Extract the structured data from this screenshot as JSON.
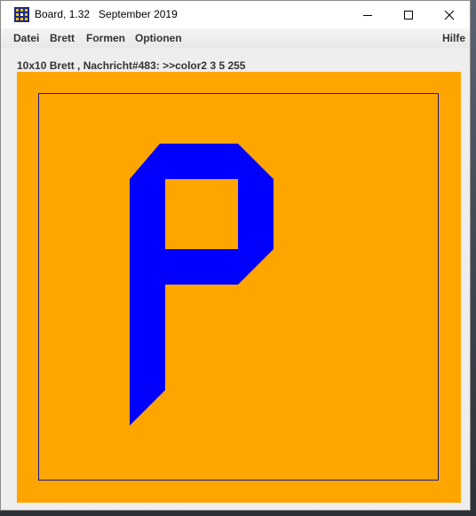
{
  "window": {
    "title": "Board, 1.32   September 2019"
  },
  "title_buttons": {
    "minimize_icon": "minimize-icon",
    "maximize_icon": "maximize-icon",
    "close_icon": "close-icon"
  },
  "menu": {
    "items": [
      "Datei",
      "Brett",
      "Formen",
      "Optionen"
    ],
    "help": "Hilfe"
  },
  "status": {
    "text": "10x10 Brett , Nachricht#483: >>color2 3 5 255"
  },
  "board": {
    "rows": 10,
    "columns": 10,
    "background_color": "#ffa500",
    "frame_color": "#1a1a8c",
    "shape_color": "#0000ff",
    "shape": "P-pentomino-like letter P shape"
  }
}
